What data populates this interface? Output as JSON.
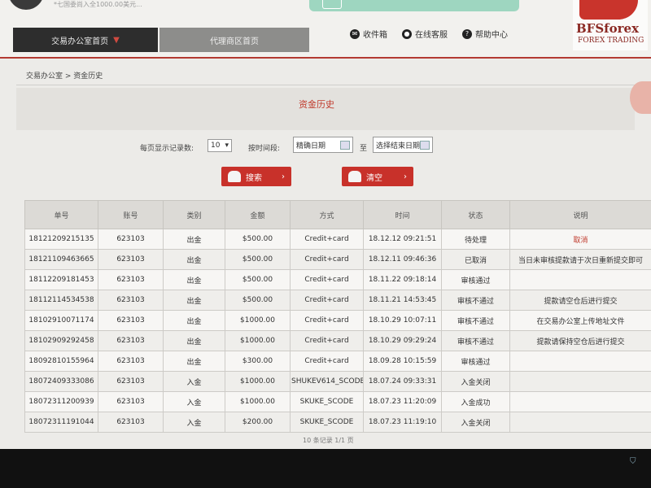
{
  "topbar": {
    "note": "*七国委尚入全1000.00美元...",
    "logo_main": "BFSforex",
    "logo_sub": "FOREX TRADING"
  },
  "nav": {
    "office_tab": "交易办公室首页",
    "agent_tab": "代理商区首页",
    "links": [
      {
        "label": "收件箱",
        "icon": "mail-icon",
        "glyph": "✉"
      },
      {
        "label": "在线客服",
        "icon": "chat-icon",
        "glyph": "●"
      },
      {
        "label": "帮助中心",
        "icon": "help-icon",
        "glyph": "?"
      }
    ]
  },
  "breadcrumb": "交易办公室 > 资金历史",
  "panel": {
    "title": "资金历史"
  },
  "filters": {
    "per_page_label": "每页显示记录数:",
    "per_page_value": "10",
    "time_label": "按时间段:",
    "start_date": "精确日期",
    "to_label": "至",
    "end_date": "选择结束日期"
  },
  "buttons": {
    "search": "搜索",
    "clear": "清空"
  },
  "table": {
    "headers": [
      "单号",
      "账号",
      "类别",
      "金额",
      "方式",
      "时间",
      "状态",
      "说明"
    ],
    "rows": [
      [
        "18121209215135",
        "623103",
        "出金",
        "$500.00",
        "Credit+card",
        "18.12.12 09:21:51",
        "待处理",
        "取消"
      ],
      [
        "18121109463665",
        "623103",
        "出金",
        "$500.00",
        "Credit+card",
        "18.12.11 09:46:36",
        "已取消",
        "当日未审核提款请于次日重新提交即可"
      ],
      [
        "18112209181453",
        "623103",
        "出金",
        "$500.00",
        "Credit+card",
        "18.11.22 09:18:14",
        "审核通过",
        ""
      ],
      [
        "18112114534538",
        "623103",
        "出金",
        "$500.00",
        "Credit+card",
        "18.11.21 14:53:45",
        "审核不通过",
        "提款请空仓后进行提交"
      ],
      [
        "18102910071174",
        "623103",
        "出金",
        "$1000.00",
        "Credit+card",
        "18.10.29 10:07:11",
        "审核不通过",
        "在交易办公室上传地址文件"
      ],
      [
        "18102909292458",
        "623103",
        "出金",
        "$1000.00",
        "Credit+card",
        "18.10.29 09:29:24",
        "审核不通过",
        "提款请保持空仓后进行提交"
      ],
      [
        "18092810155964",
        "623103",
        "出金",
        "$300.00",
        "Credit+card",
        "18.09.28 10:15:59",
        "审核通过",
        ""
      ],
      [
        "18072409333086",
        "623103",
        "入金",
        "$1000.00",
        "SHUKEV614_SCODE",
        "18.07.24 09:33:31",
        "入金关闭",
        ""
      ],
      [
        "18072311200939",
        "623103",
        "入金",
        "$1000.00",
        "SKUKE_SCODE",
        "18.07.23 11:20:09",
        "入金成功",
        ""
      ],
      [
        "18072311191044",
        "623103",
        "入金",
        "$200.00",
        "SKUKE_SCODE",
        "18.07.23 11:19:10",
        "入金关闭",
        ""
      ]
    ]
  },
  "pager": "10 条记录 1/1 页"
}
